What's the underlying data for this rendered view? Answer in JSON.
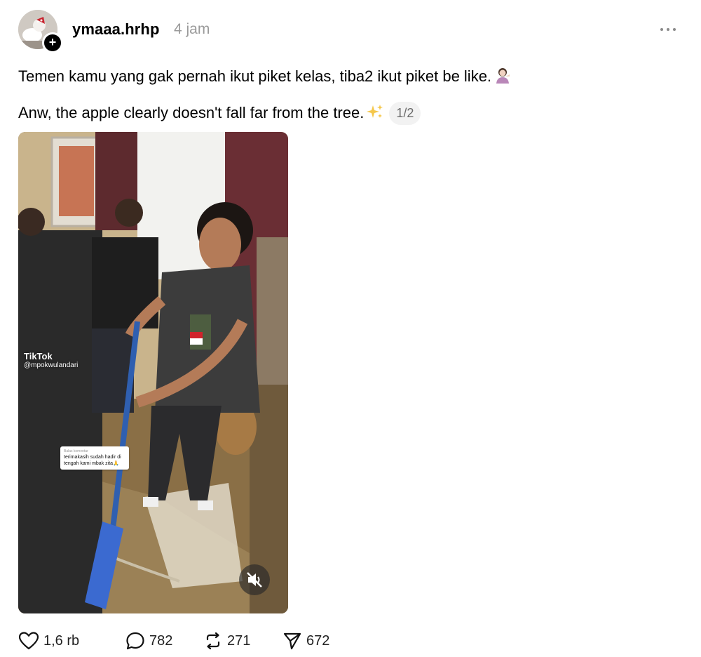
{
  "post": {
    "username": "ymaaa.hrhp",
    "timestamp": "4 jam",
    "text_line1": "Temen kamu yang gak pernah ikut piket kelas, tiba2 ikut piket be like.",
    "text_line2": "Anw, the apple clearly doesn't fall far from the tree.",
    "media_counter": "1/2",
    "emoji_line1": "woman-tipping-hand-emoji",
    "emoji_line2": "sparkles-emoji"
  },
  "media": {
    "watermark_brand": "TikTok",
    "watermark_handle": "@mpokwulandari",
    "comment_overlay_header": "Balas komentar",
    "comment_overlay_text": "terimakasih sudah hadir di tengah kami mbak zita🙏",
    "mute_icon": "speaker-muted-icon"
  },
  "actions": {
    "likes": "1,6 rb",
    "replies": "782",
    "reposts": "271",
    "shares": "672"
  },
  "icons": {
    "like": "heart-icon",
    "reply": "speech-bubble-icon",
    "repost": "repost-icon",
    "share": "send-icon",
    "more": "more-options-icon"
  },
  "colors": {
    "text": "#000000",
    "muted": "#9a9a9a",
    "badge_bg": "#f2f2f2"
  }
}
